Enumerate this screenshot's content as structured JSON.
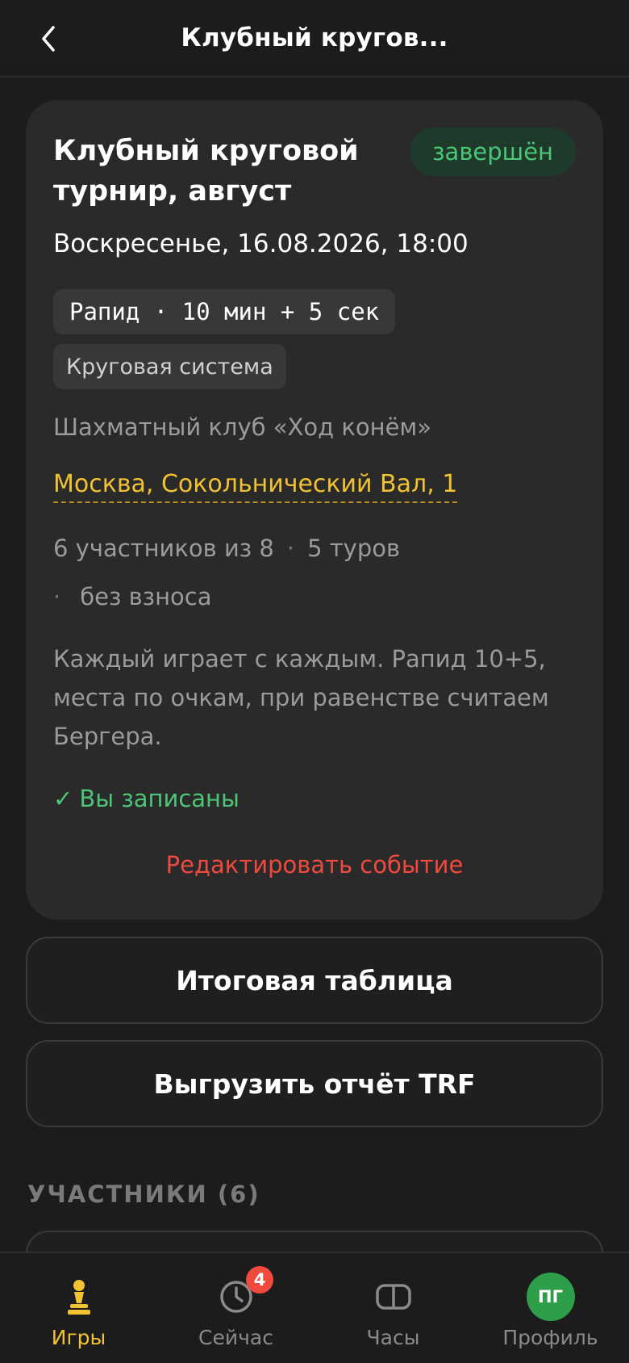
{
  "header": {
    "title": "Клубный кругов..."
  },
  "event": {
    "title": "Клубный круговой турнир, август",
    "status": "завершён",
    "datetime": "Воскресенье, 16.08.2026, 18:00",
    "time_control": "Рапид · 10 мин + 5 сек",
    "system": "Круговая система",
    "club": "Шахматный клуб «Ход конём»",
    "address": "Москва, Сокольнический Вал, 1",
    "participants": "6 участников из 8",
    "rounds": "5 туров",
    "fee": "без взноса",
    "separator": "·",
    "description": "Каждый играет с каждым. Рапид 10+5, места по очкам, при равенстве считаем Бергера.",
    "registered_check": "✓",
    "registered": "Вы записаны",
    "edit": "Редактировать событие"
  },
  "actions": {
    "standings": "Итоговая таблица",
    "export": "Выгрузить отчёт TRF"
  },
  "participants_section": {
    "title": "УЧАСТНИКИ (6)"
  },
  "tabbar": {
    "games": "Игры",
    "now": "Сейчас",
    "now_badge": "4",
    "clock": "Часы",
    "profile": "Профиль",
    "avatar_initials": "ПГ"
  },
  "colors": {
    "background": "#1c1c1c",
    "card": "#2a2a2a",
    "accent_yellow": "#f1c232",
    "success_green": "#4cc576",
    "danger_red": "#f0493e"
  }
}
